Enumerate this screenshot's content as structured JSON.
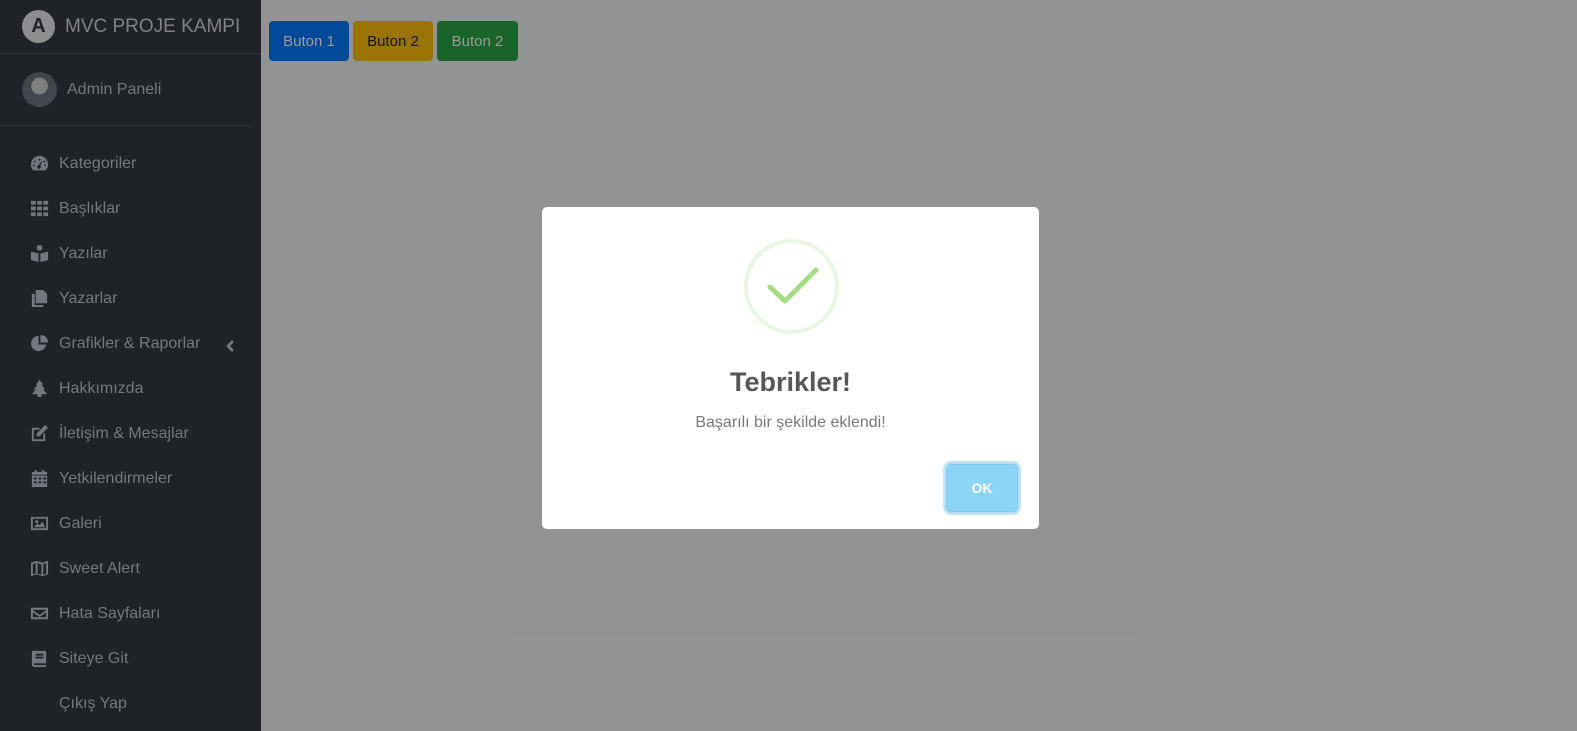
{
  "brand": {
    "title": "MVC PROJE KAMPI",
    "logo_letter": "A"
  },
  "user": {
    "name": "Admin Paneli"
  },
  "nav": {
    "items": [
      {
        "label": "Kategoriler",
        "icon": "tachometer-icon"
      },
      {
        "label": "Başlıklar",
        "icon": "grid-icon"
      },
      {
        "label": "Yazılar",
        "icon": "reader-icon"
      },
      {
        "label": "Yazarlar",
        "icon": "copy-icon"
      },
      {
        "label": "Grafikler & Raporlar",
        "icon": "pie-chart-icon",
        "has_submenu": true
      },
      {
        "label": "Hakkımızda",
        "icon": "tree-icon"
      },
      {
        "label": "İletişim & Mesajlar",
        "icon": "edit-icon"
      },
      {
        "label": "Yetkilendirmeler",
        "icon": "calendar-icon"
      },
      {
        "label": "Galeri",
        "icon": "image-icon"
      },
      {
        "label": "Sweet Alert",
        "icon": "map-icon"
      },
      {
        "label": "Hata Sayfaları",
        "icon": "envelope-icon"
      },
      {
        "label": "Siteye Git",
        "icon": "book-icon"
      },
      {
        "label": "Çıkış Yap",
        "icon": ""
      }
    ]
  },
  "toolbar": {
    "buttons": [
      {
        "label": "Buton 1",
        "color": "#007bff"
      },
      {
        "label": "Buton 2",
        "color": "#ffc107"
      },
      {
        "label": "Buton 2",
        "color": "#28a745"
      }
    ]
  },
  "alert": {
    "icon": "success-check-icon",
    "title": "Tebrikler!",
    "text": "Başarılı bir şekilde eklendi!",
    "ok_label": "OK",
    "ok_color": "#8cd4f5"
  }
}
